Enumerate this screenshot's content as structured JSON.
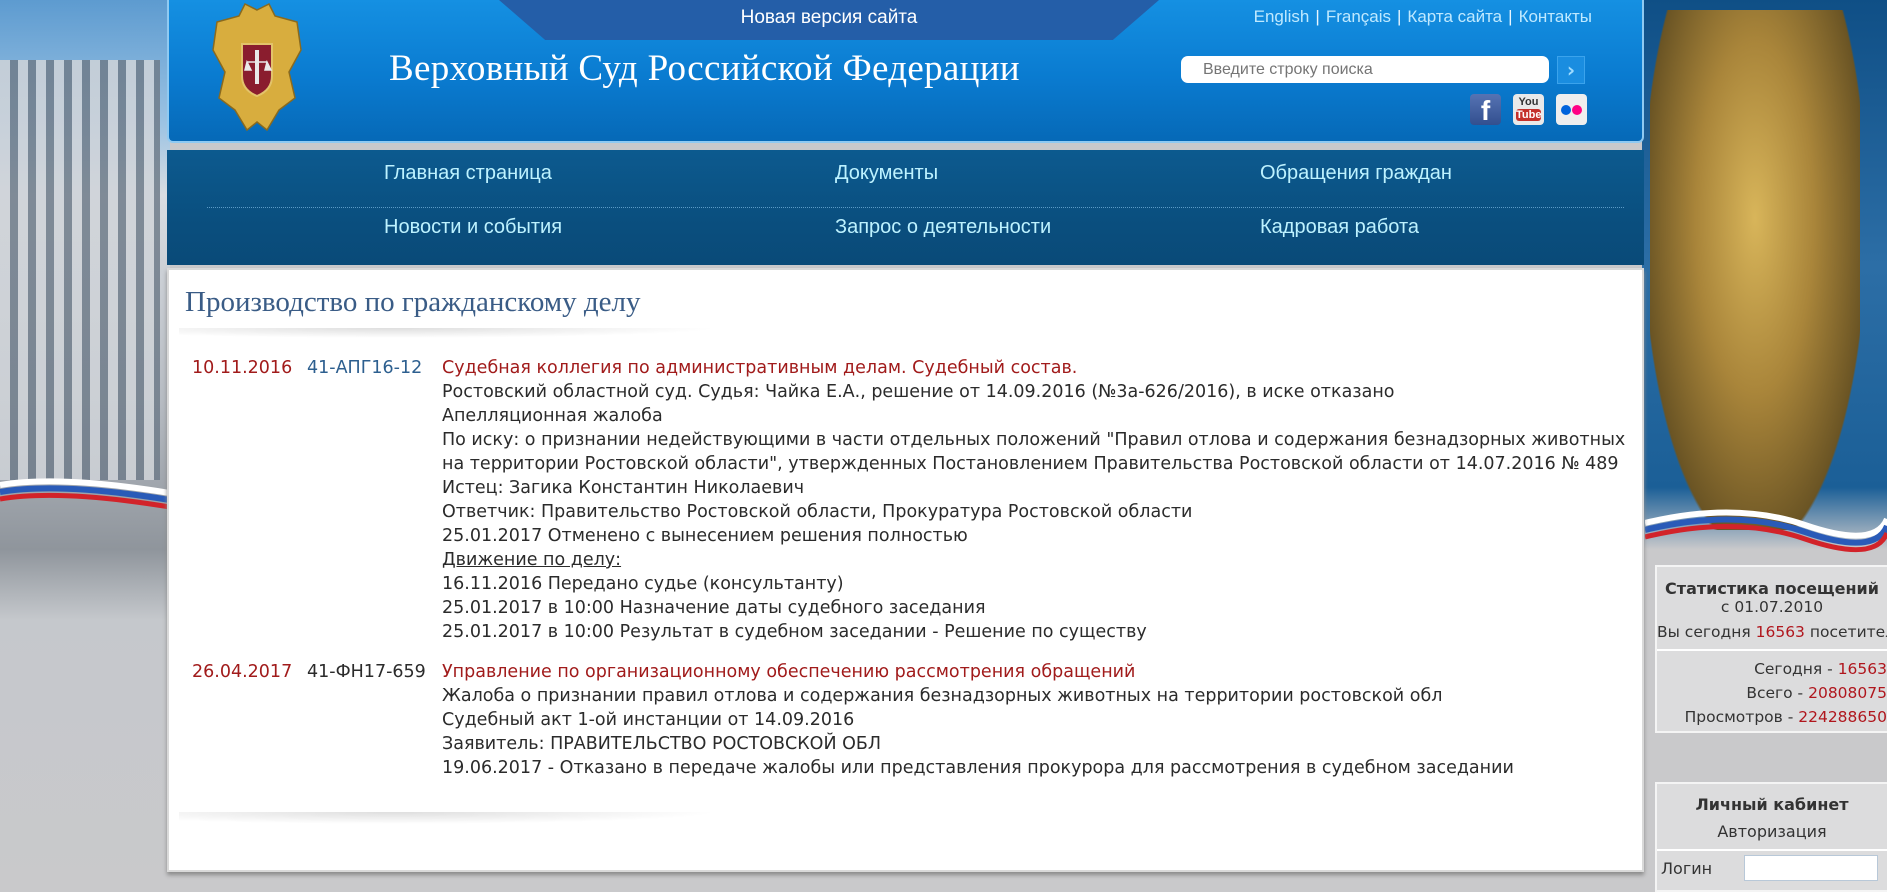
{
  "header": {
    "new_version": "Новая версия сайта",
    "site_title": "Верховный Суд Российской Федерации",
    "top_links": [
      "English",
      "Français",
      "Карта сайта",
      "Контакты"
    ],
    "search_placeholder": "Введите строку поиска",
    "search_button_icon": "chevron-right-icon",
    "social": [
      "facebook",
      "youtube",
      "flickr"
    ],
    "youtube_label_top": "You",
    "youtube_label_bottom": "Tube",
    "facebook_glyph": "f"
  },
  "nav": {
    "items": [
      "Главная страница",
      "Документы",
      "Обращения граждан",
      "Новости и события",
      "Запрос о деятельности",
      "Кадровая работа"
    ]
  },
  "main": {
    "title": "Производство по гражданскому делу",
    "cases": [
      {
        "date": "10.11.2016",
        "number": "41-АПГ16-12",
        "heading": "Судебная коллегия по административным делам. Судебный состав.",
        "lines": [
          "Ростовский областной суд. Судья: Чайка Е.А., решение от 14.09.2016 (№3а-626/2016), в иске отказано",
          "Апелляционная жалоба",
          "По иску: о признании недействующими в части отдельных положений \"Правил отлова и содержания безнадзорных животных на территории Ростовской области\", утвержденных Постановлением Правительства Ростовской области от 14.07.2016 № 489",
          "Истец: Загика Константин Николаевич",
          "Ответчик: Правительство Ростовской области, Прокуратура Ростовской области",
          "25.01.2017 Отменено с вынесением решения полностью"
        ],
        "movement_label": "Движение по делу:",
        "movement": [
          "16.11.2016 Передано судье (консультанту)",
          "25.01.2017 в 10:00 Назначение даты судебного заседания",
          "25.01.2017 в 10:00 Результат в судебном заседании - Решение по существу"
        ]
      },
      {
        "date": "26.04.2017",
        "number": "41-ФН17-659",
        "heading": "Управление по организационному обеспечению рассмотрения обращений",
        "lines": [
          "Жалоба о признании правил отлова и содержания безнадзорных животных на территории ростовской обл",
          "Судебный акт 1-ой инстанции от 14.09.2016",
          "Заявитель: ПРАВИТЕЛЬСТВО РОСТОВСКОЙ ОБЛ",
          "19.06.2017 - Отказано в передаче жалобы или представления прокурора для рассмотрения в судебном заседании"
        ]
      }
    ]
  },
  "stats": {
    "title": "Статистика посещений",
    "since": "с 01.07.2010",
    "you_prefix": "Вы сегодня",
    "you_value": "16563",
    "you_suffix": "посетитель",
    "today_label": "Сегодня -",
    "today_value": "16563",
    "total_label": "Всего -",
    "total_value": "20808075",
    "views_label": "Просмотров -",
    "views_value": "224288650"
  },
  "cabinet": {
    "title": "Личный кабинет",
    "subtitle": "Авторизация",
    "login_label": "Логин",
    "login_value": ""
  },
  "colors": {
    "accent_red": "#a11b1b",
    "header_blue": "#0a7bd0",
    "nav_blue": "#0a4f7f",
    "nav_link": "#bdf2ff",
    "title_blue": "#3a5c86"
  }
}
